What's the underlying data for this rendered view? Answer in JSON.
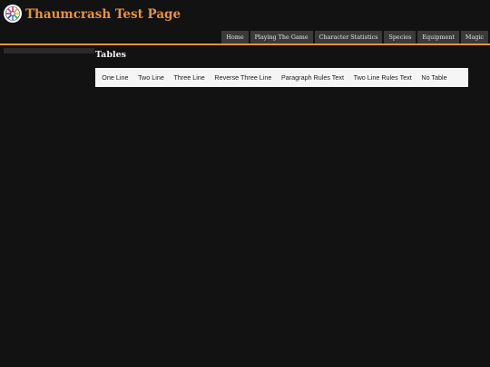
{
  "header": {
    "title": "Thaumcrash Test Page",
    "logo_icon": "wheel-logo-icon",
    "title_color": "#e8923a"
  },
  "nav": {
    "items": [
      "Home",
      "Playing The Game",
      "Character Statistics",
      "Species",
      "Equipment",
      "Magic"
    ]
  },
  "main": {
    "section_title": "Tables",
    "tabs": [
      "One Line",
      "Two Line",
      "Three Line",
      "Reverse Three Line",
      "Paragraph Rules Text",
      "Two Line Rules Text",
      "No Table"
    ]
  }
}
